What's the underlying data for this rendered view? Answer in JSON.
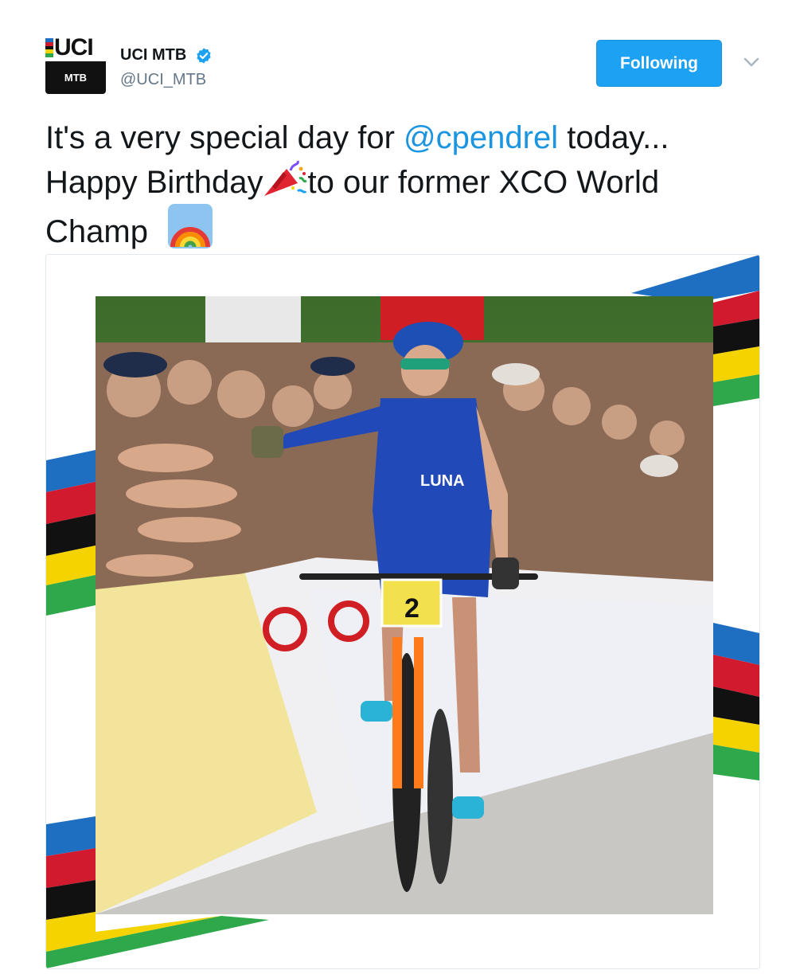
{
  "header": {
    "avatar_logo": "UCI",
    "avatar_sub": "MTB",
    "display_name": "UCI MTB",
    "handle": "@UCI_MTB",
    "follow_label": "Following"
  },
  "tweet": {
    "line1_a": "It's a very special day for ",
    "mention": "@cpendrel",
    "line1_b": " today...",
    "line2_a": "Happy Birthday",
    "line2_b": "to our former XCO World",
    "line3": "Champ",
    "emojis": [
      "party-popper-icon",
      "rainbow-icon"
    ]
  },
  "photo": {
    "bib_number": "2",
    "jersey_text": "LUNA"
  },
  "colors": {
    "brand_blue": "#1da1f2",
    "link_blue": "#1b95e0",
    "stripe_blue": "#1e6fc2",
    "stripe_red": "#d21a2e",
    "stripe_black": "#111111",
    "stripe_yellow": "#f5d300",
    "stripe_green": "#2ea84a"
  }
}
